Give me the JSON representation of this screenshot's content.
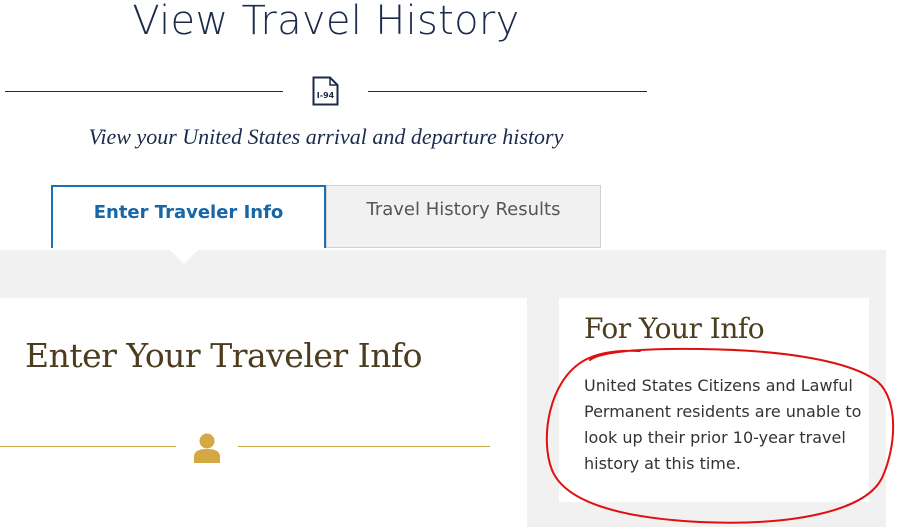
{
  "header": {
    "title": "View Travel History",
    "subtitle": "View your United States arrival and departure history",
    "icon_label": "I-94",
    "icon": "document-i94-icon"
  },
  "tabs": [
    {
      "label": "Enter Traveler Info",
      "active": true
    },
    {
      "label": "Travel History Results",
      "active": false
    }
  ],
  "main": {
    "heading": "Enter Your Traveler Info",
    "icon": "person-icon"
  },
  "info_panel": {
    "heading": "For Your Info",
    "text": "United States Citizens and Lawful Permanent residents are unable to look up their prior 10-year travel history at this time."
  },
  "colors": {
    "navy": "#1b2b4b",
    "tab_active": "#1666a8",
    "gold": "#c9a84a",
    "heading_brown": "#4d3d1f",
    "annotation_red": "#e01010",
    "panel_gray": "#f1f1f1"
  }
}
